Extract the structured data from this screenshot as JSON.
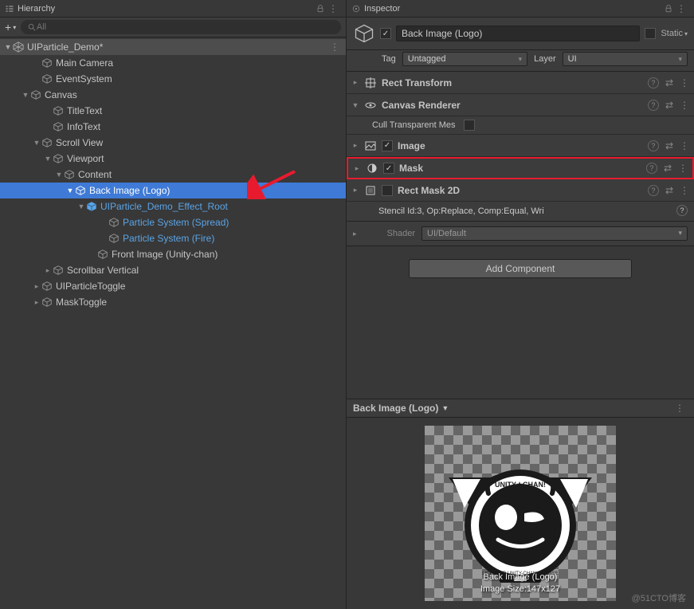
{
  "hierarchy": {
    "title": "Hierarchy",
    "search_placeholder": "All",
    "scene": "UIParticle_Demo*",
    "items": {
      "main_camera": "Main Camera",
      "event_system": "EventSystem",
      "canvas": "Canvas",
      "title_text": "TitleText",
      "info_text": "InfoText",
      "scroll_view": "Scroll View",
      "viewport": "Viewport",
      "content": "Content",
      "back_image": "Back Image (Logo)",
      "effect_root": "UIParticle_Demo_Effect_Root",
      "ps_spread": "Particle System (Spread)",
      "ps_fire": "Particle System (Fire)",
      "front_image": "Front Image (Unity-chan)",
      "scrollbar": "Scrollbar Vertical",
      "uiparticle_toggle": "UIParticleToggle",
      "mask_toggle": "MaskToggle"
    }
  },
  "inspector": {
    "title": "Inspector",
    "object_name": "Back Image (Logo)",
    "static_label": "Static",
    "tag_label": "Tag",
    "tag_value": "Untagged",
    "layer_label": "Layer",
    "layer_value": "UI",
    "components": {
      "rect_transform": "Rect Transform",
      "canvas_renderer": "Canvas Renderer",
      "cull_transparent": "Cull Transparent Mes",
      "image": "Image",
      "mask": "Mask",
      "rect_mask_2d": "Rect Mask 2D",
      "stencil_text": "Stencil Id:3, Op:Replace, Comp:Equal, Wri",
      "shader_label": "Shader",
      "shader_value": "UI/Default"
    },
    "add_component": "Add Component",
    "preview_title": "Back Image (Logo)",
    "preview_caption_1": "Back Image (Logo)",
    "preview_caption_2": "Image Size:147x127"
  },
  "watermark": "@51CTO博客"
}
